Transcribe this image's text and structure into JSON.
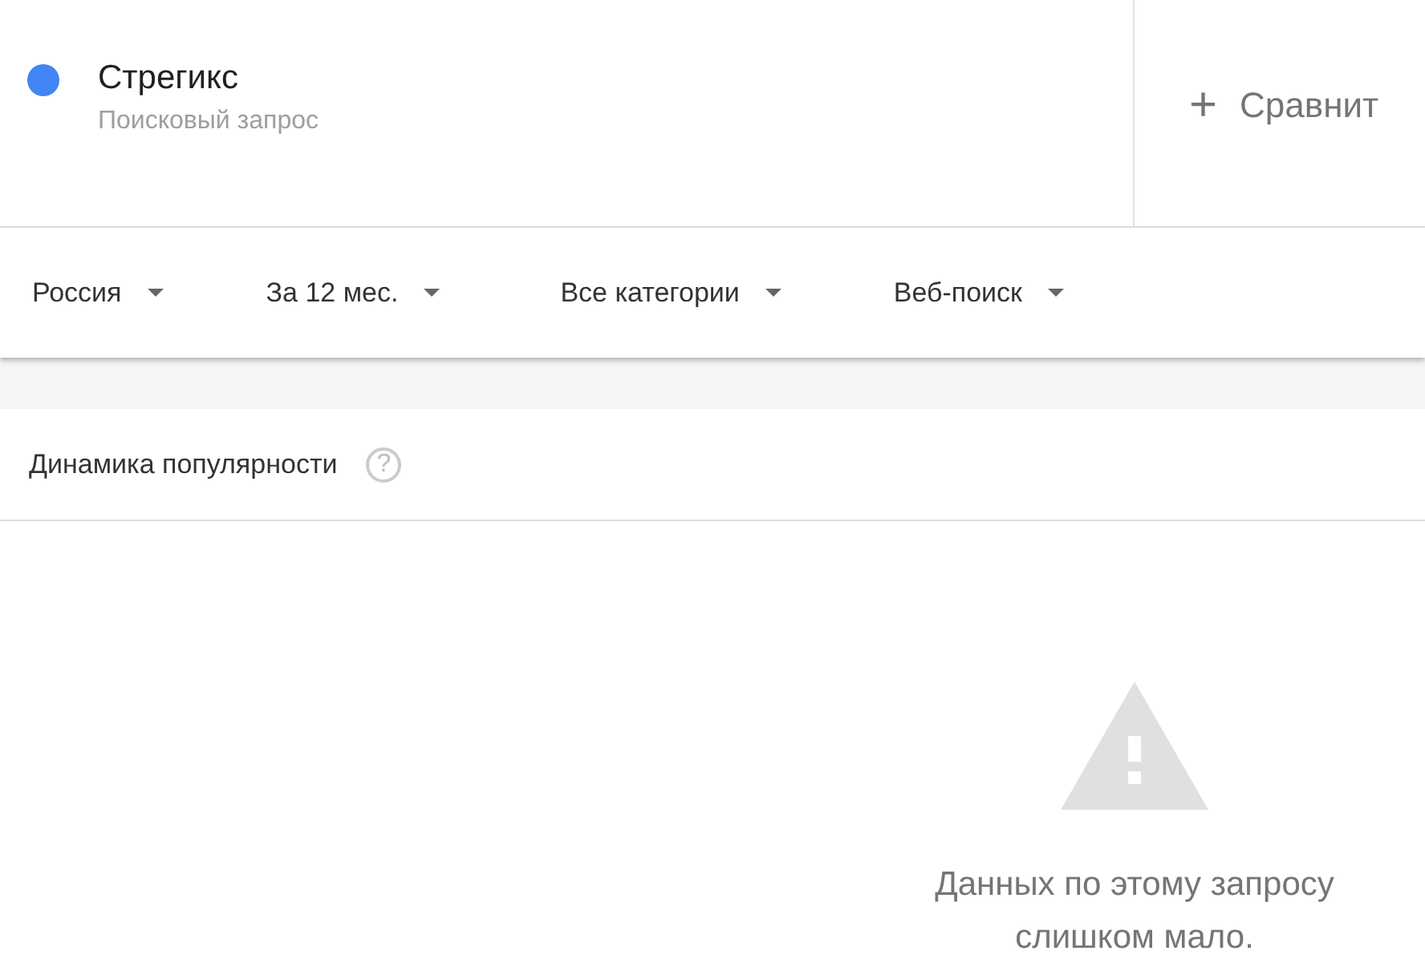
{
  "term": {
    "name": "Стрегикс",
    "subtitle": "Поисковый запрос",
    "color": "#4285f4"
  },
  "compare": {
    "icon": "+",
    "label": "Сравнит"
  },
  "filters": [
    {
      "label": "Россия"
    },
    {
      "label": "За 12 мес."
    },
    {
      "label": "Все категории"
    },
    {
      "label": "Веб-поиск"
    }
  ],
  "card": {
    "title": "Динамика популярности",
    "help": "?",
    "message": "Данных по этому запросу слишком мало."
  }
}
